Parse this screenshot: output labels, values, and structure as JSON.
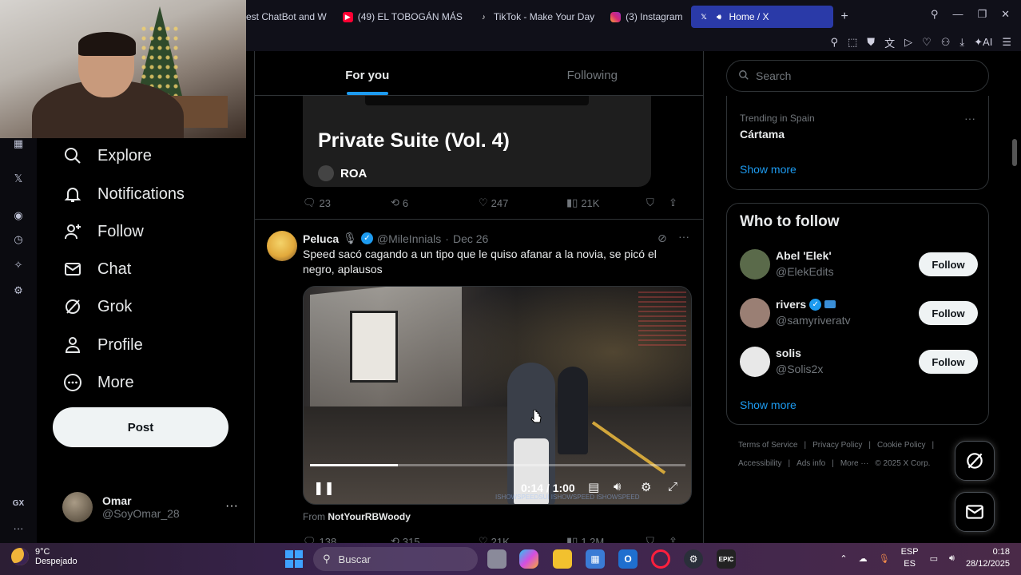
{
  "browser": {
    "tabs": [
      {
        "label": "est ChatBot and W",
        "icon": "chatbot-icon",
        "active": false
      },
      {
        "label": "(49) EL TOBOGÁN MÁS",
        "icon": "youtube-icon",
        "active": false
      },
      {
        "label": "TikTok - Make Your Day",
        "icon": "tiktok-icon",
        "active": false
      },
      {
        "label": "(3) Instagram",
        "icon": "instagram-icon",
        "active": false
      },
      {
        "label": "Home / X",
        "icon": "x-icon",
        "active": true
      }
    ],
    "new_tab": "+",
    "ai_label": "AI",
    "accent_color": "#2a3aa8"
  },
  "gx_sidebar": {
    "gx_label": "GX",
    "more": "···"
  },
  "nav": {
    "items": [
      {
        "label": "Explore",
        "icon": "search-icon"
      },
      {
        "label": "Notifications",
        "icon": "bell-icon"
      },
      {
        "label": "Follow",
        "icon": "person-add-icon"
      },
      {
        "label": "Chat",
        "icon": "envelope-icon"
      },
      {
        "label": "Grok",
        "icon": "grok-icon"
      },
      {
        "label": "Profile",
        "icon": "person-icon"
      },
      {
        "label": "More",
        "icon": "more-circle-icon"
      }
    ],
    "post_label": "Post",
    "account": {
      "name": "Omar",
      "handle": "@SoyOmar_28",
      "more": "···"
    }
  },
  "timeline": {
    "tabs": [
      {
        "label": "For you",
        "active": true
      },
      {
        "label": "Following",
        "active": false
      }
    ],
    "card": {
      "title": "Private Suite (Vol. 4)",
      "artist": "ROA"
    },
    "prev_actions": {
      "replies": "23",
      "reposts": "6",
      "likes": "247",
      "views": "21K"
    },
    "tweet": {
      "name": "Peluca",
      "handle": "@MileInnials",
      "date": "Dec 26",
      "sep": "·",
      "text": "Speed sacó cagando a un tipo que le quiso afanar a la novia, se picó el negro, aplausos",
      "video": {
        "time": "0:14 / 1:00",
        "progress": 0.233,
        "watermark": "ISHOWSPEEDSUI ISHOWSPEED ISHOWSPEED"
      },
      "from_prefix": "From",
      "from_user": "NotYourRBWoody",
      "actions": {
        "replies": "138",
        "reposts": "315",
        "likes": "21K",
        "views": "1.2M"
      }
    }
  },
  "right": {
    "search_placeholder": "Search",
    "trend": {
      "sub": "Trending in Spain",
      "name": "Cártama",
      "more": "···"
    },
    "show_more": "Show more",
    "wtf_title": "Who to follow",
    "follow_label": "Follow",
    "suggestions": [
      {
        "name": "Abel 'Elek'",
        "handle": "@ElekEdits",
        "verified": false,
        "avatar_color": "#5a6a4a"
      },
      {
        "name": "rivers",
        "handle": "@samyriveratv",
        "verified": true,
        "avatar_color": "#9a7f74"
      },
      {
        "name": "solis",
        "handle": "@Solis2x",
        "verified": false,
        "avatar_color": "#e8e8e8"
      }
    ],
    "footer_links": [
      "Terms of Service",
      "Privacy Policy",
      "Cookie Policy",
      "Accessibility",
      "Ads info",
      "More ···",
      "© 2025 X Corp."
    ]
  },
  "taskbar": {
    "temp": "9°C",
    "weather": "Despejado",
    "search": "Buscar",
    "lang1": "ESP",
    "lang2": "ES",
    "time": "0:18",
    "date": "28/12/2025"
  }
}
